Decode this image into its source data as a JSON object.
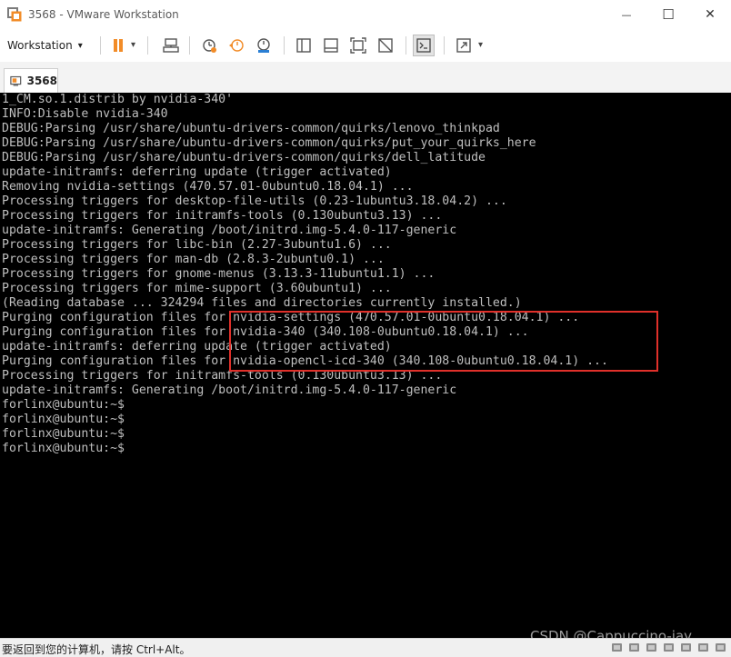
{
  "window": {
    "title": "3568 - VMware Workstation",
    "minimize_glyph": "—",
    "maximize_glyph": "☐",
    "close_glyph": "✕"
  },
  "toolbar": {
    "menu_label": "Workstation",
    "menu_caret": "▾",
    "pause_caret": "▾",
    "fullscreen_caret": "▾",
    "buttons": [
      "suspend-icon",
      "send-ctrl-alt-del-icon",
      "snapshot-icon",
      "revert-snapshot-icon",
      "snapshot-manager-icon",
      "library-icon",
      "single-window-icon",
      "fit-guest-icon",
      "stretch-icon",
      "console-view-icon",
      "fullscreen-icon"
    ],
    "accent_color": "#f28c28"
  },
  "tab": {
    "label": "3568"
  },
  "console": {
    "lines": [
      "1_CM.so.1.distrib by nvidia-340'",
      "INFO:Disable nvidia-340",
      "DEBUG:Parsing /usr/share/ubuntu-drivers-common/quirks/lenovo_thinkpad",
      "DEBUG:Parsing /usr/share/ubuntu-drivers-common/quirks/put_your_quirks_here",
      "DEBUG:Parsing /usr/share/ubuntu-drivers-common/quirks/dell_latitude",
      "update-initramfs: deferring update (trigger activated)",
      "Removing nvidia-settings (470.57.01-0ubuntu0.18.04.1) ...",
      "Processing triggers for desktop-file-utils (0.23-1ubuntu3.18.04.2) ...",
      "Processing triggers for initramfs-tools (0.130ubuntu3.13) ...",
      "update-initramfs: Generating /boot/initrd.img-5.4.0-117-generic",
      "Processing triggers for libc-bin (2.27-3ubuntu1.6) ...",
      "Processing triggers for man-db (2.8.3-2ubuntu0.1) ...",
      "Processing triggers for gnome-menus (3.13.3-11ubuntu1.1) ...",
      "Processing triggers for mime-support (3.60ubuntu1) ...",
      "(Reading database ... 324294 files and directories currently installed.)",
      "Purging configuration files for nvidia-settings (470.57.01-0ubuntu0.18.04.1) ...",
      "Purging configuration files for nvidia-340 (340.108-0ubuntu0.18.04.1) ...",
      "update-initramfs: deferring update (trigger activated)",
      "Purging configuration files for nvidia-opencl-icd-340 (340.108-0ubuntu0.18.04.1) ...",
      "Processing triggers for initramfs-tools (0.130ubuntu3.13) ...",
      "update-initramfs: Generating /boot/initrd.img-5.4.0-117-generic",
      "forlinx@ubuntu:~$",
      "forlinx@ubuntu:~$",
      "forlinx@ubuntu:~$",
      "forlinx@ubuntu:~$"
    ],
    "text_color": "#bfbfbf",
    "background": "#000000",
    "highlight_color": "#e0302a"
  },
  "watermark": "CSDN @Cappuccino-jay",
  "status_bar": {
    "text": "要返回到您的计算机，请按 Ctrl+Alt。",
    "icons": [
      "hard-disk-icon",
      "cd-icon",
      "network-icon",
      "usb-icon",
      "sound-icon",
      "printer-icon",
      "display-icon"
    ]
  }
}
